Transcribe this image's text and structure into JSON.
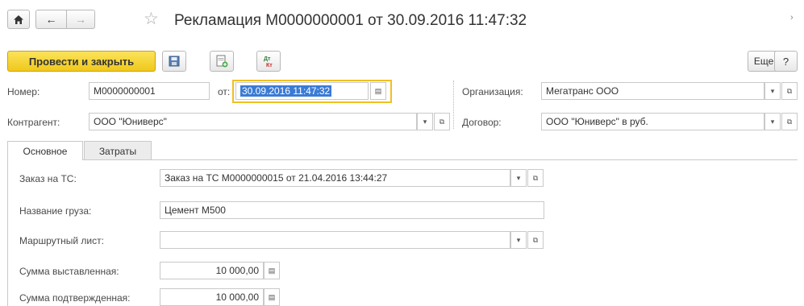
{
  "header": {
    "title": "Рекламация М0000000001 от 30.09.2016 11:47:32",
    "home_icon": "home-icon",
    "back_icon": "arrow-left-icon",
    "forward_icon": "arrow-right-icon",
    "favorite_icon": "star-outline-icon"
  },
  "toolbar": {
    "post_close_label": "Провести и закрыть",
    "more_label": "Еще",
    "help_label": "?"
  },
  "form": {
    "number": {
      "label": "Номер:",
      "value": "М0000000001"
    },
    "date": {
      "label": "от:",
      "value": "30.09.2016 11:47:32"
    },
    "organization": {
      "label": "Организация:",
      "value": "Мегатранс ООО"
    },
    "counterparty": {
      "label": "Контрагент:",
      "value": "ООО \"Юниверс\""
    },
    "contract": {
      "label": "Договор:",
      "value": "ООО \"Юниверс\" в руб."
    }
  },
  "tabs": [
    {
      "label": "Основное",
      "active": true
    },
    {
      "label": "Затраты",
      "active": false
    }
  ],
  "main": {
    "order": {
      "label": "Заказ на ТС:",
      "value": "Заказ на ТС М0000000015 от 21.04.2016 13:44:27"
    },
    "cargo": {
      "label": "Название груза:",
      "value": "Цемент М500"
    },
    "route": {
      "label": "Маршрутный лист:",
      "value": ""
    },
    "amount_invoiced": {
      "label": "Сумма выставленная:",
      "value": "10 000,00"
    },
    "amount_confirmed": {
      "label": "Сумма подтвержденная:",
      "value": "10 000,00"
    }
  },
  "colors": {
    "accent_yellow": "#f5d12a",
    "selection_blue": "#3a7bd5",
    "focus_border": "#f0c020"
  }
}
